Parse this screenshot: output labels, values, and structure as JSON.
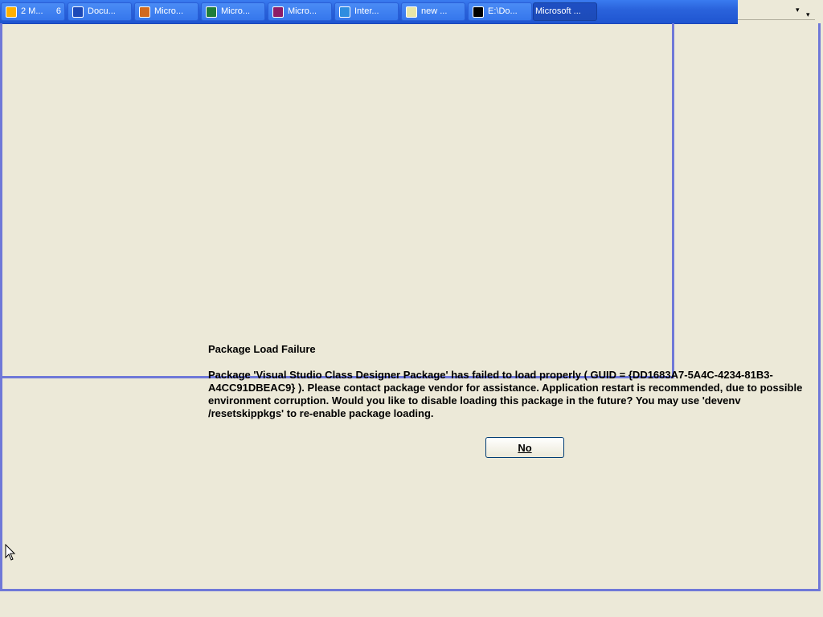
{
  "taskbar": {
    "buttons": [
      {
        "label": "2 M...",
        "count": "6",
        "icon": "window-group-icon",
        "color": "#ffb000"
      },
      {
        "label": "Docu...",
        "icon": "word-icon",
        "color": "#1c49b8"
      },
      {
        "label": "Micro...",
        "icon": "powerpoint-icon",
        "color": "#d26a1e"
      },
      {
        "label": "Micro...",
        "icon": "excel-icon",
        "color": "#1f7d3a"
      },
      {
        "label": "Micro...",
        "icon": "publisher-icon",
        "color": "#8d1c67"
      },
      {
        "label": "Inter...",
        "icon": "internet-explorer-icon",
        "color": "#2e8de0"
      },
      {
        "label": "new ...",
        "icon": "notepad-icon",
        "color": "#e8e6a8"
      },
      {
        "label": "E:\\Do...",
        "icon": "command-prompt-icon",
        "color": "#000000"
      },
      {
        "label": "Microsoft ...",
        "icon": "",
        "color": "#1d4bb8",
        "active": true
      }
    ]
  },
  "dialog": {
    "title": "Package Load Failure",
    "message": "Package 'Visual Studio Class Designer Package' has failed to load properly ( GUID = {DD1683A7-5A4C-4234-81B3-A4CC91DBEAC9} ). Please contact package vendor for assistance. Application restart is recommended, due to possible environment corruption. Would you like to disable loading this package in the future? You may use 'devenv /resetskippkgs' to re-enable package loading.",
    "no_label": "No"
  },
  "colors": {
    "background": "#ece9d8",
    "window_border": "#6f78d8",
    "taskbar": "#2a63dc"
  }
}
